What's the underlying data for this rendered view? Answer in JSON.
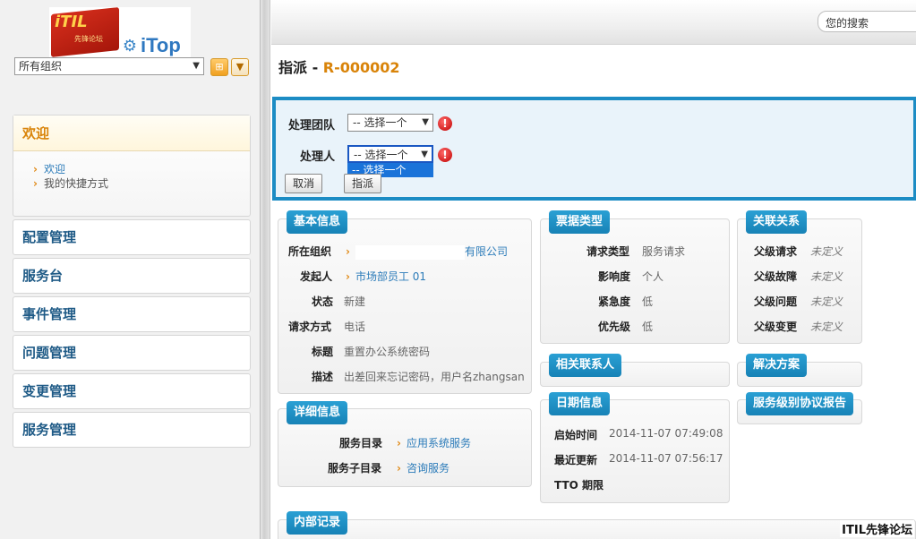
{
  "sidebar": {
    "logo": {
      "flag_title": "iTIL",
      "flag_sub": "先锋论坛",
      "brand": "iTop"
    },
    "org_select": {
      "value": "所有组织"
    },
    "org_buttons": [
      "⊞",
      "▼"
    ],
    "welcome": {
      "label": "欢迎",
      "items": [
        {
          "label": "欢迎"
        },
        {
          "label": "我的快捷方式"
        }
      ]
    },
    "menus": [
      {
        "label": "配置管理"
      },
      {
        "label": "服务台"
      },
      {
        "label": "事件管理"
      },
      {
        "label": "问题管理"
      },
      {
        "label": "变更管理"
      },
      {
        "label": "服务管理"
      }
    ]
  },
  "header": {
    "search": {
      "value": "您的搜索"
    },
    "title_prefix": "指派",
    "title_sep": " - ",
    "title_ref": "R-000002"
  },
  "dispatch_form": {
    "team_label": "处理团队",
    "team_value": "-- 选择一个",
    "agent_label": "处理人",
    "agent_value": "-- 选择一个",
    "agent_option": "-- 选择一个",
    "error_mark": "!",
    "cancel_label": "取消",
    "assign_label": "指派"
  },
  "panels": {
    "basic": {
      "title": "基本信息",
      "rows": [
        {
          "label": "所在组织",
          "value": "有限公司"
        },
        {
          "label": "发起人",
          "value": "市场部员工 01"
        },
        {
          "label": "状态",
          "value": "新建"
        },
        {
          "label": "请求方式",
          "value": "电话"
        },
        {
          "label": "标题",
          "value": "重置办公系统密码"
        },
        {
          "label": "描述",
          "value": "出差回来忘记密码，用户名zhangsan"
        }
      ]
    },
    "ticket_type": {
      "title": "票据类型",
      "rows": [
        {
          "label": "请求类型",
          "value": "服务请求"
        },
        {
          "label": "影响度",
          "value": "个人"
        },
        {
          "label": "紧急度",
          "value": "低"
        },
        {
          "label": "优先级",
          "value": "低"
        }
      ]
    },
    "relations": {
      "title": "关联关系",
      "rows": [
        {
          "label": "父级请求",
          "value": "未定义"
        },
        {
          "label": "父级故障",
          "value": "未定义"
        },
        {
          "label": "父级问题",
          "value": "未定义"
        },
        {
          "label": "父级变更",
          "value": "未定义"
        }
      ]
    },
    "contacts": {
      "title": "相关联系人"
    },
    "solution": {
      "title": "解决方案"
    },
    "sla": {
      "title": "服务级别协议报告"
    },
    "details": {
      "title": "详细信息",
      "rows": [
        {
          "label": "服务目录",
          "value": "应用系统服务"
        },
        {
          "label": "服务子目录",
          "value": "咨询服务"
        }
      ]
    },
    "dates": {
      "title": "日期信息",
      "rows": [
        {
          "label": "启始时间",
          "value": "2014-11-07 07:49:08"
        },
        {
          "label": "最近更新",
          "value": "2014-11-07 07:56:17"
        },
        {
          "label": "TTO 期限",
          "value": ""
        }
      ]
    },
    "internal": {
      "title": "内部记录"
    }
  },
  "watermark": "ITIL先锋论坛"
}
